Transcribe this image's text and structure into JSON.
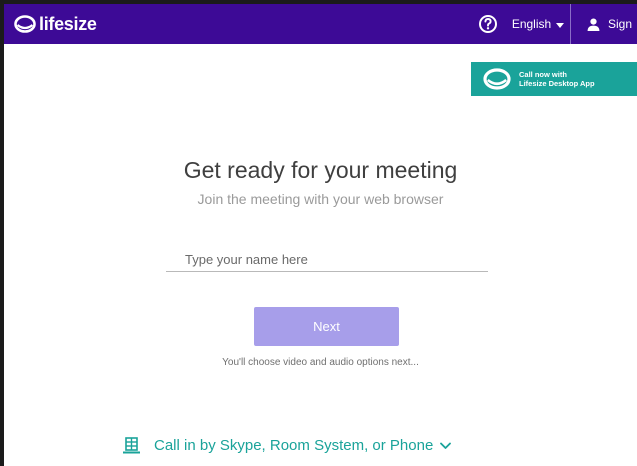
{
  "header": {
    "logo_text": "lifesize",
    "help_icon": "question-circle-icon",
    "language": "English",
    "signin_label": "Sign",
    "brand_color": "#3d0a96"
  },
  "desktop_app": {
    "line1": "Call now with",
    "line2": "Lifesize Desktop App",
    "color": "#1aa39a"
  },
  "main": {
    "title": "Get ready for your meeting",
    "subtitle": "Join the meeting with your web browser",
    "name_input": {
      "placeholder": "Type your name here",
      "value": ""
    },
    "next_label": "Next",
    "hint": "You'll choose video and audio options next...",
    "next_color": "#a79eea"
  },
  "callin": {
    "label": "Call in by Skype, Room System, or Phone",
    "icon": "building-icon",
    "chevron": "chevron-down-icon"
  }
}
